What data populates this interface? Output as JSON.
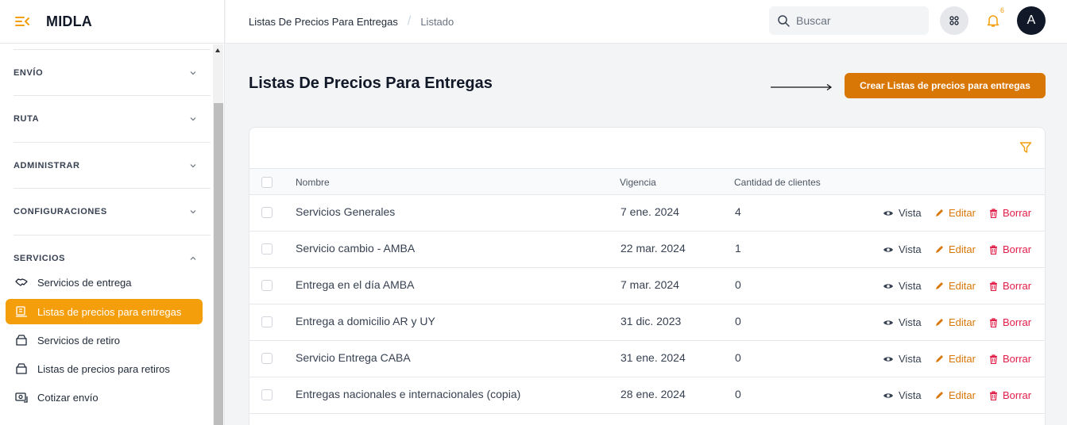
{
  "app": {
    "title": "MIDLA"
  },
  "sidebar": {
    "sections": [
      {
        "label": "ENVÍO",
        "expanded": false
      },
      {
        "label": "RUTA",
        "expanded": false
      },
      {
        "label": "ADMINISTRAR",
        "expanded": false
      },
      {
        "label": "CONFIGURACIONES",
        "expanded": false
      },
      {
        "label": "SERVICIOS",
        "expanded": true
      }
    ],
    "items": [
      {
        "label": "Servicios de entrega",
        "icon": "handshake-icon",
        "active": false
      },
      {
        "label": "Listas de precios para entregas",
        "icon": "price-list-icon",
        "active": true
      },
      {
        "label": "Servicios de retiro",
        "icon": "box-icon",
        "active": false
      },
      {
        "label": "Listas de precios para retiros",
        "icon": "box-icon",
        "active": false
      },
      {
        "label": "Cotizar envío",
        "icon": "quote-icon",
        "active": false
      }
    ]
  },
  "topbar": {
    "breadcrumb": [
      "Listas De Precios Para Entregas",
      "Listado"
    ],
    "search_placeholder": "Buscar",
    "notifications_count": "6",
    "avatar_initial": "A"
  },
  "main": {
    "title": "Listas De Precios Para Entregas",
    "create_button": "Crear Listas de precios para entregas",
    "table": {
      "columns": [
        "Nombre",
        "Vigencia",
        "Cantidad de clientes"
      ],
      "actions": {
        "view": "Vista",
        "edit": "Editar",
        "delete": "Borrar"
      },
      "rows": [
        {
          "name": "Servicios Generales",
          "validity": "7 ene. 2024",
          "clients": "4"
        },
        {
          "name": "Servicio cambio - AMBA",
          "validity": "22 mar. 2024",
          "clients": "1"
        },
        {
          "name": "Entrega en el día AMBA",
          "validity": "7 mar. 2024",
          "clients": "0"
        },
        {
          "name": "Entrega a domicilio AR y UY",
          "validity": "31 dic. 2023",
          "clients": "0"
        },
        {
          "name": "Servicio Entrega CABA",
          "validity": "31 ene. 2024",
          "clients": "0"
        },
        {
          "name": "Entregas nacionales e internacionales (copia)",
          "validity": "28 ene. 2024",
          "clients": "0"
        }
      ]
    }
  },
  "colors": {
    "accent": "#f59e0b",
    "accent_dark": "#d97706",
    "danger": "#e11d48"
  }
}
